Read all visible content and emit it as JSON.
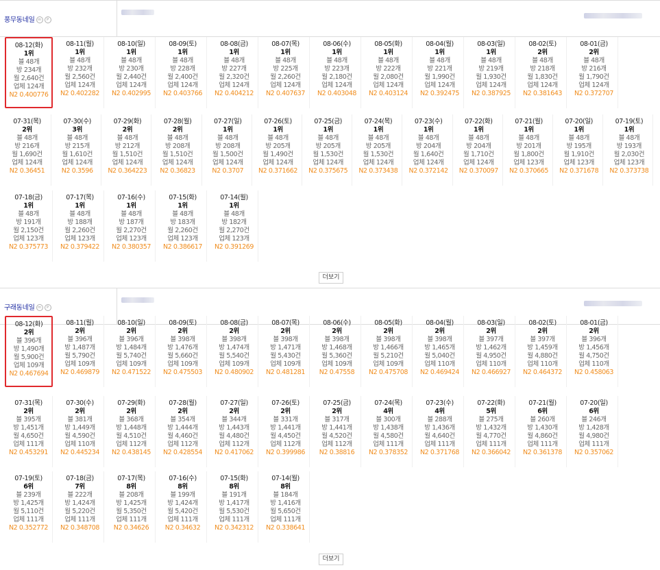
{
  "sections": [
    {
      "name": "풍무동네일",
      "more_label": "더보기",
      "rows": [
        [
          {
            "date": "08-12(화)",
            "rank": "1위",
            "blog": "블 48개",
            "room": "방 234개",
            "month": "월 2,640건",
            "biz": "업체 124개",
            "n2": "N2 0.400776",
            "hl": true
          },
          {
            "date": "08-11(월)",
            "rank": "1위",
            "blog": "블 48개",
            "room": "방 232개",
            "month": "월 2,560건",
            "biz": "업체 124개",
            "n2": "N2 0.402282"
          },
          {
            "date": "08-10(일)",
            "rank": "1위",
            "blog": "블 48개",
            "room": "방 230개",
            "month": "월 2,440건",
            "biz": "업체 124개",
            "n2": "N2 0.402995"
          },
          {
            "date": "08-09(토)",
            "rank": "1위",
            "blog": "블 48개",
            "room": "방 228개",
            "month": "월 2,400건",
            "biz": "업체 124개",
            "n2": "N2 0.403766"
          },
          {
            "date": "08-08(금)",
            "rank": "1위",
            "blog": "블 48개",
            "room": "방 227개",
            "month": "월 2,320건",
            "biz": "업체 124개",
            "n2": "N2 0.404212"
          },
          {
            "date": "08-07(목)",
            "rank": "1위",
            "blog": "블 48개",
            "room": "방 225개",
            "month": "월 2,260건",
            "biz": "업체 124개",
            "n2": "N2 0.407637"
          },
          {
            "date": "08-06(수)",
            "rank": "1위",
            "blog": "블 48개",
            "room": "방 223개",
            "month": "월 2,180건",
            "biz": "업체 124개",
            "n2": "N2 0.403048"
          },
          {
            "date": "08-05(화)",
            "rank": "1위",
            "blog": "블 48개",
            "room": "방 222개",
            "month": "월 2,080건",
            "biz": "업체 124개",
            "n2": "N2 0.403124"
          },
          {
            "date": "08-04(월)",
            "rank": "1위",
            "blog": "블 48개",
            "room": "방 221개",
            "month": "월 1,990건",
            "biz": "업체 124개",
            "n2": "N2 0.392475"
          },
          {
            "date": "08-03(일)",
            "rank": "1위",
            "blog": "블 48개",
            "room": "방 219개",
            "month": "월 1,930건",
            "biz": "업체 124개",
            "n2": "N2 0.387925"
          },
          {
            "date": "08-02(토)",
            "rank": "2위",
            "blog": "블 48개",
            "room": "방 218개",
            "month": "월 1,830건",
            "biz": "업체 124개",
            "n2": "N2 0.381643"
          },
          {
            "date": "08-01(금)",
            "rank": "2위",
            "blog": "블 48개",
            "room": "방 216개",
            "month": "월 1,790건",
            "biz": "업체 124개",
            "n2": "N2 0.372707"
          }
        ],
        [
          {
            "date": "07-31(목)",
            "rank": "2위",
            "blog": "블 48개",
            "room": "방 216개",
            "month": "월 1,690건",
            "biz": "업체 124개",
            "n2": "N2 0.36451"
          },
          {
            "date": "07-30(수)",
            "rank": "3위",
            "blog": "블 48개",
            "room": "방 215개",
            "month": "월 1,610건",
            "biz": "업체 124개",
            "n2": "N2 0.3596"
          },
          {
            "date": "07-29(화)",
            "rank": "2위",
            "blog": "블 48개",
            "room": "방 212개",
            "month": "월 1,510건",
            "biz": "업체 124개",
            "n2": "N2 0.364223"
          },
          {
            "date": "07-28(월)",
            "rank": "2위",
            "blog": "블 48개",
            "room": "방 208개",
            "month": "월 1,510건",
            "biz": "업체 124개",
            "n2": "N2 0.36823"
          },
          {
            "date": "07-27(일)",
            "rank": "1위",
            "blog": "블 48개",
            "room": "방 208개",
            "month": "월 1,500건",
            "biz": "업체 124개",
            "n2": "N2 0.3707"
          },
          {
            "date": "07-26(토)",
            "rank": "1위",
            "blog": "블 48개",
            "room": "방 205개",
            "month": "월 1,490건",
            "biz": "업체 124개",
            "n2": "N2 0.371662"
          },
          {
            "date": "07-25(금)",
            "rank": "1위",
            "blog": "블 48개",
            "room": "방 205개",
            "month": "월 1,530건",
            "biz": "업체 124개",
            "n2": "N2 0.375675"
          },
          {
            "date": "07-24(목)",
            "rank": "1위",
            "blog": "블 48개",
            "room": "방 205개",
            "month": "월 1,530건",
            "biz": "업체 124개",
            "n2": "N2 0.373438"
          },
          {
            "date": "07-23(수)",
            "rank": "1위",
            "blog": "블 48개",
            "room": "방 204개",
            "month": "월 1,640건",
            "biz": "업체 124개",
            "n2": "N2 0.372142"
          },
          {
            "date": "07-22(화)",
            "rank": "1위",
            "blog": "블 48개",
            "room": "방 204개",
            "month": "월 1,710건",
            "biz": "업체 124개",
            "n2": "N2 0.370097"
          },
          {
            "date": "07-21(월)",
            "rank": "1위",
            "blog": "블 48개",
            "room": "방 201개",
            "month": "월 1,800건",
            "biz": "업체 123개",
            "n2": "N2 0.370665"
          },
          {
            "date": "07-20(일)",
            "rank": "1위",
            "blog": "블 48개",
            "room": "방 195개",
            "month": "월 1,910건",
            "biz": "업체 123개",
            "n2": "N2 0.371678"
          },
          {
            "date": "07-19(토)",
            "rank": "1위",
            "blog": "블 48개",
            "room": "방 193개",
            "month": "월 2,030건",
            "biz": "업체 123개",
            "n2": "N2 0.373738"
          }
        ],
        [
          {
            "date": "07-18(금)",
            "rank": "1위",
            "blog": "블 48개",
            "room": "방 191개",
            "month": "월 2,150건",
            "biz": "업체 123개",
            "n2": "N2 0.375773"
          },
          {
            "date": "07-17(목)",
            "rank": "1위",
            "blog": "블 48개",
            "room": "방 188개",
            "month": "월 2,260건",
            "biz": "업체 123개",
            "n2": "N2 0.379422"
          },
          {
            "date": "07-16(수)",
            "rank": "1위",
            "blog": "블 48개",
            "room": "방 187개",
            "month": "월 2,270건",
            "biz": "업체 123개",
            "n2": "N2 0.380357"
          },
          {
            "date": "07-15(화)",
            "rank": "1위",
            "blog": "블 48개",
            "room": "방 183개",
            "month": "월 2,260건",
            "biz": "업체 123개",
            "n2": "N2 0.386617"
          },
          {
            "date": "07-14(월)",
            "rank": "1위",
            "blog": "블 48개",
            "room": "방 182개",
            "month": "월 2,270건",
            "biz": "업체 123개",
            "n2": "N2 0.391269"
          }
        ]
      ]
    },
    {
      "name": "구래동네일",
      "more_label": "더보기",
      "rows": [
        [
          {
            "date": "08-12(화)",
            "rank": "2위",
            "blog": "블 396개",
            "room": "방 1,490개",
            "month": "월 5,900건",
            "biz": "업체 109개",
            "n2": "N2 0.467694",
            "hl": true
          },
          {
            "date": "08-11(월)",
            "rank": "2위",
            "blog": "블 396개",
            "room": "방 1,487개",
            "month": "월 5,790건",
            "biz": "업체 109개",
            "n2": "N2 0.469879"
          },
          {
            "date": "08-10(일)",
            "rank": "2위",
            "blog": "블 396개",
            "room": "방 1,484개",
            "month": "월 5,740건",
            "biz": "업체 109개",
            "n2": "N2 0.471522"
          },
          {
            "date": "08-09(토)",
            "rank": "2위",
            "blog": "블 398개",
            "room": "방 1,476개",
            "month": "월 5,660건",
            "biz": "업체 109개",
            "n2": "N2 0.475503"
          },
          {
            "date": "08-08(금)",
            "rank": "2위",
            "blog": "블 398개",
            "room": "방 1,474개",
            "month": "월 5,540건",
            "biz": "업체 109개",
            "n2": "N2 0.480902"
          },
          {
            "date": "08-07(목)",
            "rank": "2위",
            "blog": "블 398개",
            "room": "방 1,471개",
            "month": "월 5,430건",
            "biz": "업체 109개",
            "n2": "N2 0.481281"
          },
          {
            "date": "08-06(수)",
            "rank": "2위",
            "blog": "블 398개",
            "room": "방 1,468개",
            "month": "월 5,360건",
            "biz": "업체 109개",
            "n2": "N2 0.47558"
          },
          {
            "date": "08-05(화)",
            "rank": "2위",
            "blog": "블 398개",
            "room": "방 1,466개",
            "month": "월 5,210건",
            "biz": "업체 109개",
            "n2": "N2 0.475708"
          },
          {
            "date": "08-04(월)",
            "rank": "2위",
            "blog": "블 398개",
            "room": "방 1,465개",
            "month": "월 5,040건",
            "biz": "업체 110개",
            "n2": "N2 0.469424"
          },
          {
            "date": "08-03(일)",
            "rank": "2위",
            "blog": "블 397개",
            "room": "방 1,462개",
            "month": "월 4,950건",
            "biz": "업체 110개",
            "n2": "N2 0.466927"
          },
          {
            "date": "08-02(토)",
            "rank": "2위",
            "blog": "블 397개",
            "room": "방 1,459개",
            "month": "월 4,880건",
            "biz": "업체 110개",
            "n2": "N2 0.464372"
          },
          {
            "date": "08-01(금)",
            "rank": "2위",
            "blog": "블 396개",
            "room": "방 1,456개",
            "month": "월 4,750건",
            "biz": "업체 110개",
            "n2": "N2 0.458063"
          }
        ],
        [
          {
            "date": "07-31(목)",
            "rank": "2위",
            "blog": "블 395개",
            "room": "방 1,451개",
            "month": "월 4,650건",
            "biz": "업체 111개",
            "n2": "N2 0.453291"
          },
          {
            "date": "07-30(수)",
            "rank": "2위",
            "blog": "블 381개",
            "room": "방 1,449개",
            "month": "월 4,590건",
            "biz": "업체 110개",
            "n2": "N2 0.445234"
          },
          {
            "date": "07-29(화)",
            "rank": "2위",
            "blog": "블 368개",
            "room": "방 1,448개",
            "month": "월 4,510건",
            "biz": "업체 112개",
            "n2": "N2 0.438145"
          },
          {
            "date": "07-28(월)",
            "rank": "2위",
            "blog": "블 354개",
            "room": "방 1,444개",
            "month": "월 4,460건",
            "biz": "업체 112개",
            "n2": "N2 0.428554"
          },
          {
            "date": "07-27(일)",
            "rank": "2위",
            "blog": "블 344개",
            "room": "방 1,443개",
            "month": "월 4,480건",
            "biz": "업체 112개",
            "n2": "N2 0.417062"
          },
          {
            "date": "07-26(토)",
            "rank": "2위",
            "blog": "블 331개",
            "room": "방 1,441개",
            "month": "월 4,450건",
            "biz": "업체 112개",
            "n2": "N2 0.399986"
          },
          {
            "date": "07-25(금)",
            "rank": "2위",
            "blog": "블 317개",
            "room": "방 1,441개",
            "month": "월 4,520건",
            "biz": "업체 112개",
            "n2": "N2 0.38816"
          },
          {
            "date": "07-24(목)",
            "rank": "4위",
            "blog": "블 300개",
            "room": "방 1,438개",
            "month": "월 4,580건",
            "biz": "업체 111개",
            "n2": "N2 0.378352"
          },
          {
            "date": "07-23(수)",
            "rank": "4위",
            "blog": "블 288개",
            "room": "방 1,436개",
            "month": "월 4,640건",
            "biz": "업체 111개",
            "n2": "N2 0.371768"
          },
          {
            "date": "07-22(화)",
            "rank": "5위",
            "blog": "블 275개",
            "room": "방 1,432개",
            "month": "월 4,770건",
            "biz": "업체 111개",
            "n2": "N2 0.366042"
          },
          {
            "date": "07-21(월)",
            "rank": "6위",
            "blog": "블 260개",
            "room": "방 1,430개",
            "month": "월 4,860건",
            "biz": "업체 111개",
            "n2": "N2 0.361378"
          },
          {
            "date": "07-20(일)",
            "rank": "6위",
            "blog": "블 246개",
            "room": "방 1,428개",
            "month": "월 4,980건",
            "biz": "업체 111개",
            "n2": "N2 0.357062"
          }
        ],
        [
          {
            "date": "07-19(토)",
            "rank": "6위",
            "blog": "블 239개",
            "room": "방 1,425개",
            "month": "월 5,110건",
            "biz": "업체 111개",
            "n2": "N2 0.352772"
          },
          {
            "date": "07-18(금)",
            "rank": "7위",
            "blog": "블 222개",
            "room": "방 1,424개",
            "month": "월 5,220건",
            "biz": "업체 111개",
            "n2": "N2 0.348708"
          },
          {
            "date": "07-17(목)",
            "rank": "8위",
            "blog": "블 208개",
            "room": "방 1,425개",
            "month": "월 5,350건",
            "biz": "업체 111개",
            "n2": "N2 0.34626"
          },
          {
            "date": "07-16(수)",
            "rank": "8위",
            "blog": "블 199개",
            "room": "방 1,424개",
            "month": "월 5,420건",
            "biz": "업체 111개",
            "n2": "N2 0.34632"
          },
          {
            "date": "07-15(화)",
            "rank": "8위",
            "blog": "블 191개",
            "room": "방 1,417개",
            "month": "월 5,530건",
            "biz": "업체 111개",
            "n2": "N2 0.342312"
          },
          {
            "date": "07-14(월)",
            "rank": "8위",
            "blog": "블 184개",
            "room": "방 1,416개",
            "month": "월 5,650건",
            "biz": "업체 111개",
            "n2": "N2 0.338641"
          }
        ]
      ]
    }
  ],
  "colors": {
    "accent_name": "#2330a3",
    "n2": "#f08c1c",
    "highlight": "#e0282c"
  }
}
